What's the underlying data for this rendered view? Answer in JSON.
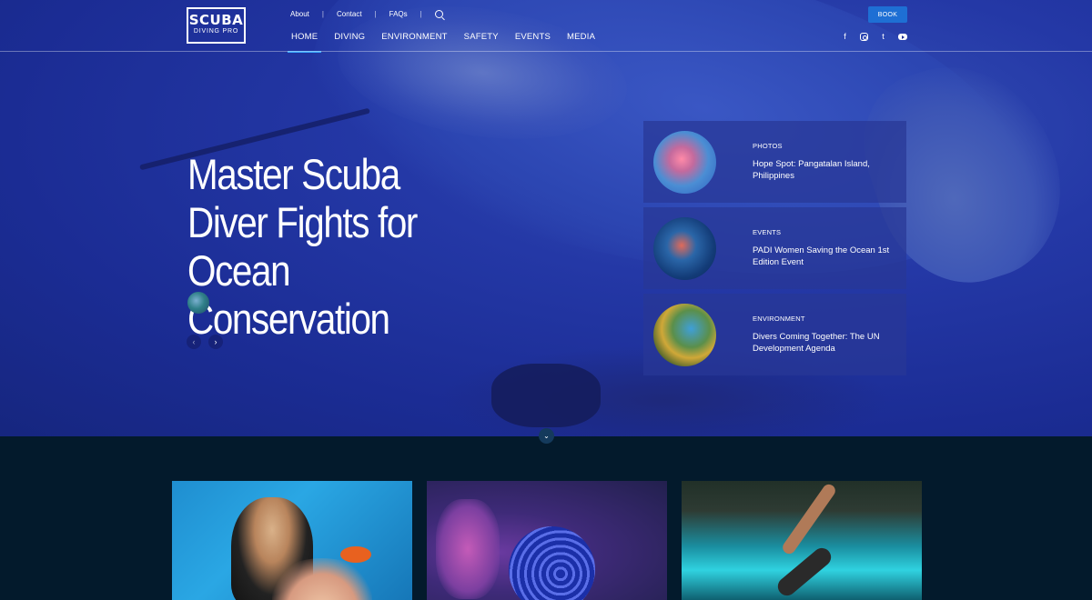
{
  "brand": {
    "line1": "SCUBA",
    "line2": "DIVING PRO"
  },
  "topnav": {
    "about": "About",
    "contact": "Contact",
    "faqs": "FAQs",
    "sep": "|"
  },
  "mainnav": [
    "HOME",
    "DIVING",
    "ENVIRONMENT",
    "SAFETY",
    "EVENTS",
    "MEDIA"
  ],
  "active_nav": "HOME",
  "book_label": "BOOK",
  "social": {
    "facebook": "f",
    "twitter": "t"
  },
  "hero": {
    "headline": "Master Scuba Diver Fights for Ocean Conservation",
    "prev_arrow": "‹",
    "next_arrow": "›"
  },
  "cards": [
    {
      "category": "PHOTOS",
      "title": "Hope Spot: Pangatalan Island, Philippines"
    },
    {
      "category": "EVENTS",
      "title": "PADI Women Saving the Ocean 1st Edition Event"
    },
    {
      "category": "ENVIRONMENT",
      "title": "Divers Coming Together: The UN Development Agenda"
    }
  ],
  "scroll_icon": "⌄",
  "colors": {
    "accent": "#1e6fd4",
    "active_underline": "#3aa7ff",
    "footer_bg": "#031a2c"
  }
}
